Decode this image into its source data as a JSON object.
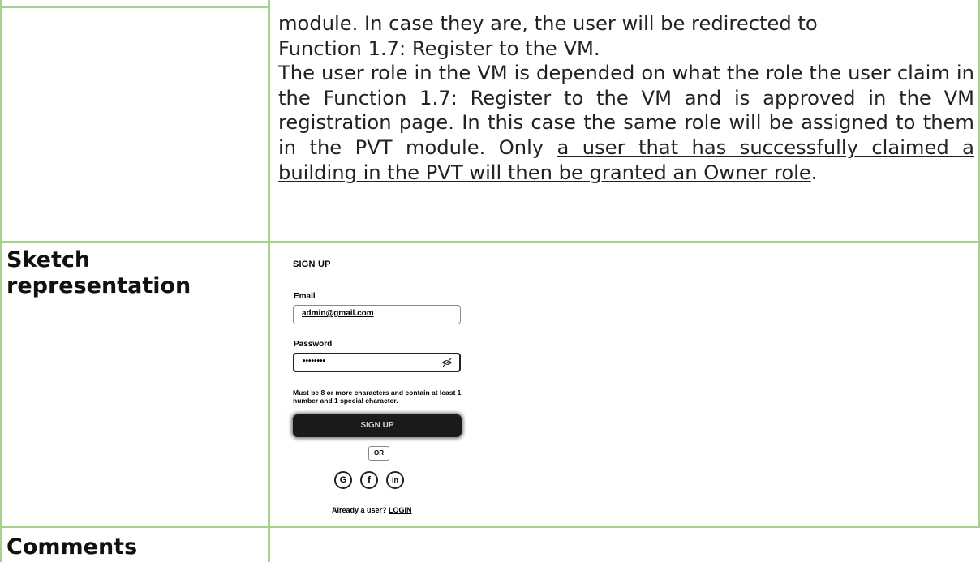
{
  "description": {
    "line1": "module. In case they are, the user will be redirected to",
    "line2": "Function 1.7: Register to the VM.",
    "para2_text": "The user role in the VM is depended on what the role the user claim in the Function 1.7: Register to the VM and is approved in the VM registration page. In this case the same role will be assigned to them in the PVT module. Only ",
    "para2_underlined": "a user that has successfully claimed a building in the PVT will then be granted an Owner role",
    "para2_end": "."
  },
  "rows": {
    "sketch_label": "Sketch representation",
    "comments_label": "Comments"
  },
  "sketch": {
    "title": "SIGN UP",
    "email_label": "Email",
    "email_value": "admin@gmail.com",
    "password_label": "Password",
    "password_value": "••••••••",
    "password_hint": "Must be 8 or more characters and contain at least 1 number and 1 special character.",
    "signup_button": "SIGN UP",
    "or_text": "OR",
    "social": [
      {
        "label": "G",
        "icon": "google-icon"
      },
      {
        "label": "f",
        "icon": "facebook-icon"
      },
      {
        "label": "in",
        "icon": "linkedin-icon"
      }
    ],
    "footer_text": "Already a user? ",
    "login_link": "LOGIN"
  },
  "colors": {
    "table_border": "#a9d18e"
  }
}
